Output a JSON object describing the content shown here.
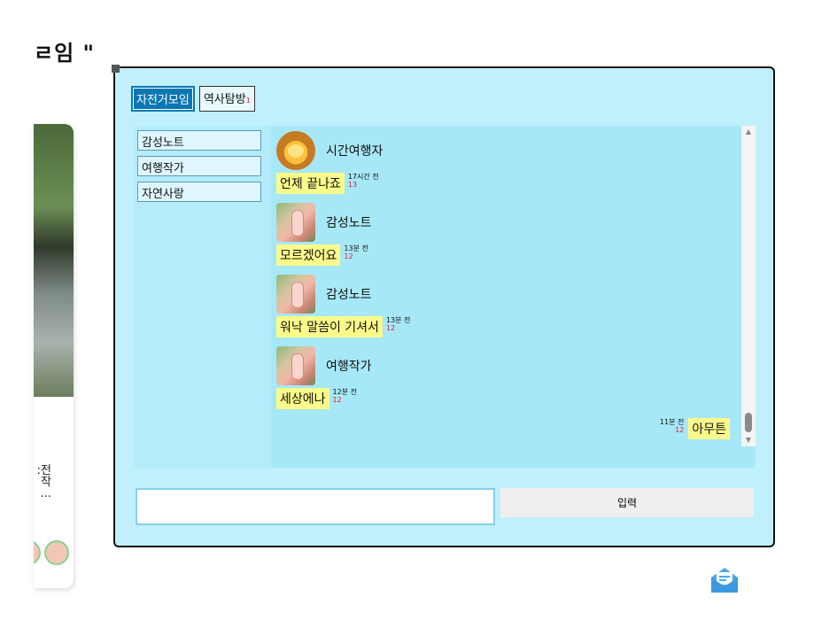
{
  "page": {
    "heading_fragment": "ㄹ임 \""
  },
  "background_card": {
    "text_lines": [
      ":전",
      "작",
      "..."
    ]
  },
  "chat": {
    "room_tabs": [
      {
        "label": "자전거모임",
        "badge": "",
        "active": true
      },
      {
        "label": "역사탐방",
        "badge": "1",
        "active": false
      }
    ],
    "users": [
      "감성노트",
      "여행작가",
      "자연사랑"
    ],
    "messages": [
      {
        "sender": "시간여행자",
        "avatar": "lion-avatar",
        "text": "언제 끝나죠",
        "time": "17시간 전",
        "count": "13"
      },
      {
        "sender": "감성노트",
        "avatar": "photo-avatar",
        "text": "모르겠어요",
        "time": "13분 전",
        "count": "12"
      },
      {
        "sender": "감성노트",
        "avatar": "photo-avatar",
        "text": "워낙 말씀이 기셔서",
        "time": "13분 전",
        "count": "12"
      },
      {
        "sender": "여행작가",
        "avatar": "photo-avatar",
        "text": "세상에나",
        "time": "12분 전",
        "count": "12"
      }
    ],
    "my_message": {
      "text": "아무튼",
      "time": "11분 전",
      "count": "12"
    },
    "input": {
      "value": "",
      "placeholder": ""
    },
    "send_label": "입력"
  },
  "icons": {
    "mail": "envelope-open-icon",
    "scroll_up": "scroll-up-arrow-icon",
    "scroll_down": "scroll-down-arrow-icon"
  },
  "colors": {
    "window_bg": "#bff0fc",
    "active_tab": "#0a77b4",
    "bubble": "#fafa8a",
    "badge": "#dd2233",
    "mail_icon": "#4aa8e8"
  }
}
